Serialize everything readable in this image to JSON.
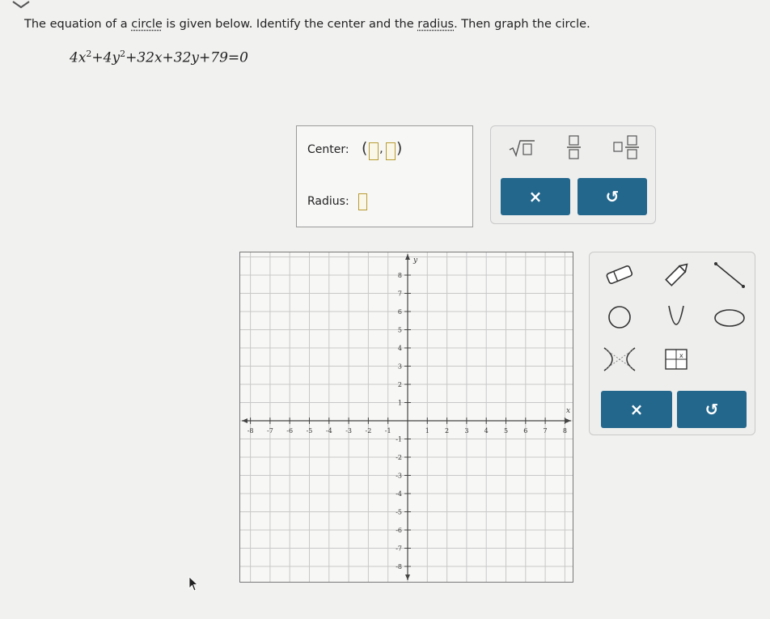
{
  "prompt": {
    "before": "The equation of a ",
    "link1": "circle",
    "middle": " is given below. Identify the center and the ",
    "link2": "radius",
    "after": ". Then graph the circle."
  },
  "equation": {
    "a": "4x",
    "exp1": "2",
    "b": "+4y",
    "exp2": "2",
    "c": "+32x+32y+79=0"
  },
  "answer": {
    "center_label": "Center:",
    "radius_label": "Radius:",
    "center_x_value": "",
    "center_y_value": "",
    "radius_value": ""
  },
  "toolbar": {
    "clear_symbol": "×",
    "undo_symbol": "↺",
    "buttons": [
      "sqrt-icon",
      "fraction-icon",
      "mixed-number-icon",
      "clear-button",
      "undo-button"
    ]
  },
  "graph_tools": {
    "clear_symbol": "×",
    "undo_symbol": "↺",
    "tools": [
      "eraser-icon",
      "pencil-icon",
      "line-icon",
      "circle-icon",
      "parabola-icon",
      "ellipse-icon",
      "hyperbola-icon",
      "points-table-icon"
    ]
  },
  "graph": {
    "x_axis_label": "x",
    "y_axis_label": "y",
    "x_ticks": [
      "-8",
      "-7",
      "-6",
      "-5",
      "-4",
      "-3",
      "-2",
      "-1",
      "1",
      "2",
      "3",
      "4",
      "5",
      "6",
      "7",
      "8"
    ],
    "y_ticks": [
      "8",
      "7",
      "6",
      "5",
      "4",
      "3",
      "2",
      "1",
      "-1",
      "-2",
      "-3",
      "-4",
      "-5",
      "-6",
      "-7",
      "-8"
    ],
    "range": [
      -9,
      9
    ],
    "grid": true
  },
  "colors": {
    "accent": "#23678d",
    "slot_border": "#b79b2f"
  }
}
